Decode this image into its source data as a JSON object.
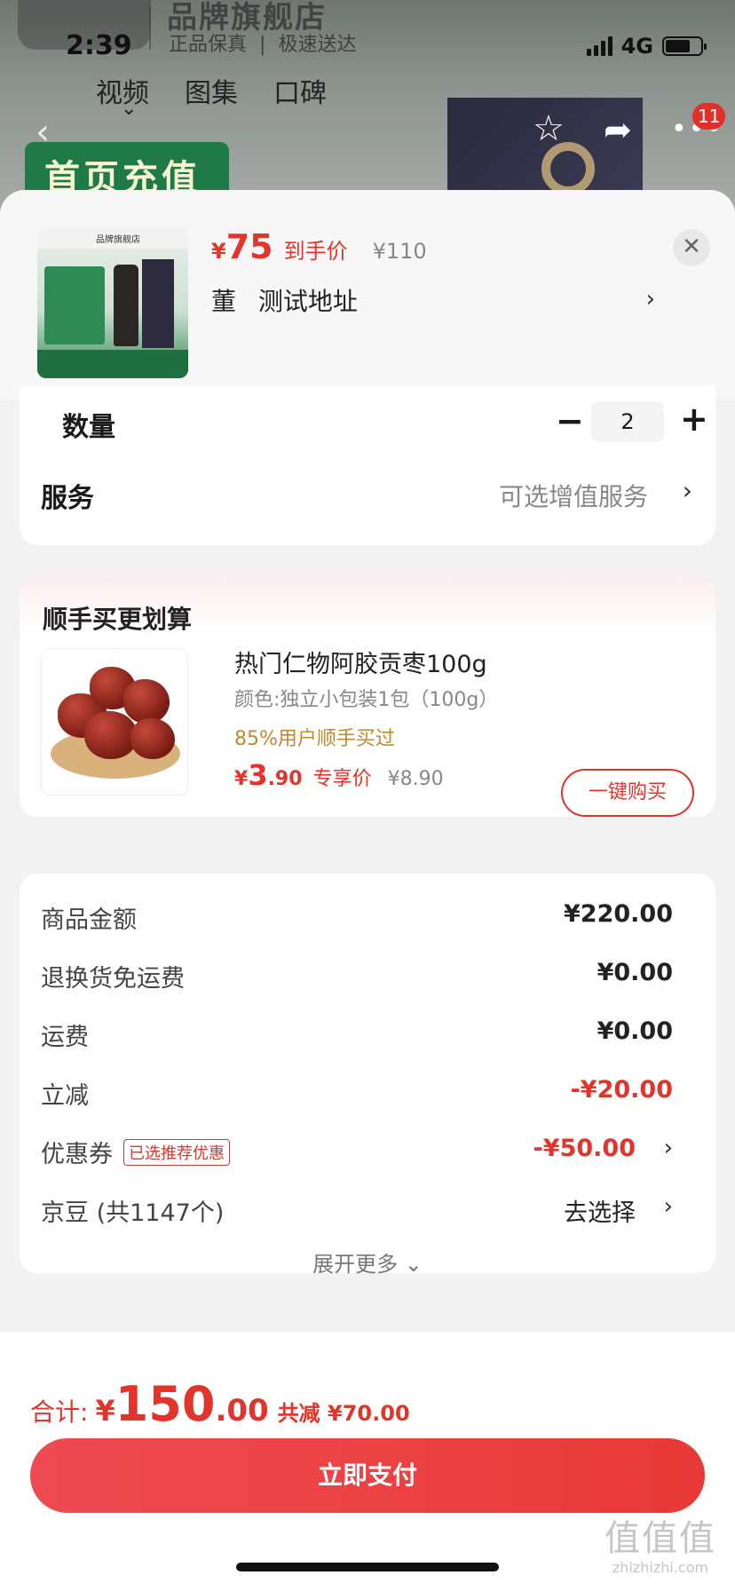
{
  "status_bar": {
    "time": "2:39",
    "network": "4G"
  },
  "background_page": {
    "store_name": "品牌旗舰店",
    "store_tags": [
      "正品保真",
      "极速送达"
    ],
    "tabs": [
      "视频",
      "图集",
      "口碑"
    ],
    "banner_text": "首页充值",
    "cart_badge": "11"
  },
  "product_sheet": {
    "price_currency": "¥",
    "price": "75",
    "price_label": "到手价",
    "original_price": "¥110",
    "recipient": "董",
    "address": "测试地址",
    "thumbnail_store_label": "品牌旗舰店"
  },
  "options": {
    "quantity_label": "数量",
    "quantity_minus": "−",
    "quantity_value": "2",
    "quantity_plus": "+",
    "service_label": "服务",
    "service_value": "可选增值服务"
  },
  "addon": {
    "title": "顺手买更划算",
    "product_name": "热门仁物阿胶贡枣100g",
    "variant": "颜色:独立小包装1包（100g）",
    "social_proof": "85%用户顺手买过",
    "price_currency": "¥",
    "price_int": "3",
    "price_dec": ".90",
    "price_label": "专享价",
    "original_price": "¥8.90",
    "buy_button": "一键购买"
  },
  "fees": {
    "rows": [
      {
        "label": "商品金额",
        "value": "¥220.00"
      },
      {
        "label": "退换货免运费",
        "value": "¥0.00"
      },
      {
        "label": "运费",
        "value": "¥0.00"
      },
      {
        "label": "立减",
        "value": "-¥20.00"
      },
      {
        "label": "优惠券",
        "tag": "已选推荐优惠",
        "value": "-¥50.00"
      },
      {
        "label": "京豆 (共1147个)",
        "value": "去选择"
      }
    ],
    "expand_more": "展开更多"
  },
  "footer": {
    "total_label": "合计:",
    "total_currency": "¥",
    "total_int": "150",
    "total_dec": ".00",
    "total_saved": "共减 ¥70.00",
    "pay_button": "立即支付"
  },
  "watermark": {
    "glyphs": "值值值",
    "site": "zhizhizhi.com"
  },
  "colors": {
    "accent_red": "#e3342b",
    "pay_gradient_start": "#ee4a52",
    "pay_gradient_end": "#e83a37",
    "gold_text": "#c08a2d"
  }
}
